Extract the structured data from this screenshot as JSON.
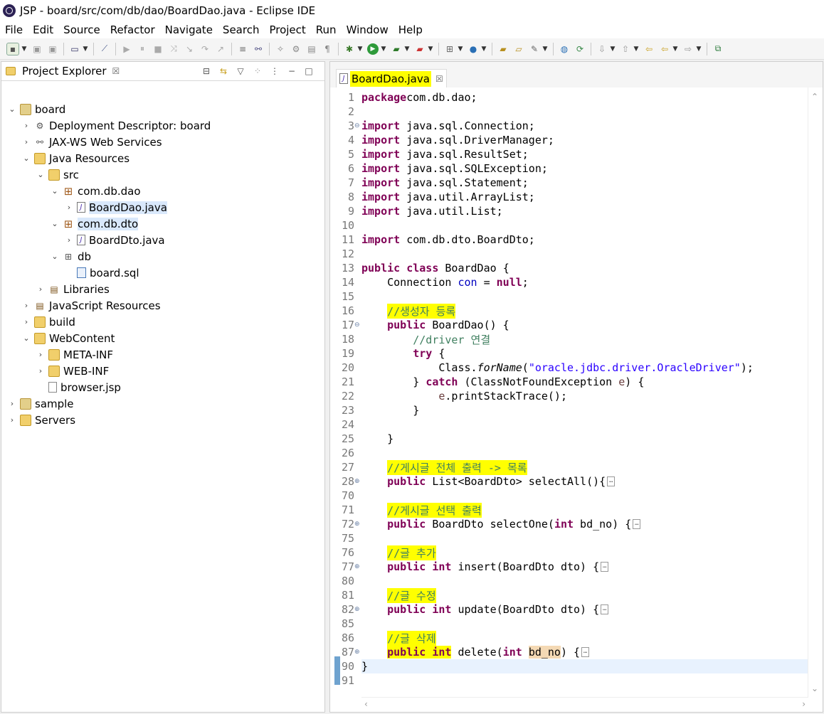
{
  "window": {
    "title": "JSP - board/src/com/db/dao/BoardDao.java - Eclipse IDE"
  },
  "menu": [
    "File",
    "Edit",
    "Source",
    "Refactor",
    "Navigate",
    "Search",
    "Project",
    "Run",
    "Window",
    "Help"
  ],
  "explorer": {
    "tab_label": "Project Explorer",
    "close_glyph": "☒",
    "tree": [
      {
        "label": "board",
        "depth": 0,
        "twisty": "open",
        "icon": "project"
      },
      {
        "label": "Deployment Descriptor: board",
        "depth": 1,
        "twisty": "closed",
        "icon": "descriptor"
      },
      {
        "label": "JAX-WS Web Services",
        "depth": 1,
        "twisty": "closed",
        "icon": "webservice"
      },
      {
        "label": "Java Resources",
        "depth": 1,
        "twisty": "open",
        "icon": "folder"
      },
      {
        "label": "src",
        "depth": 2,
        "twisty": "open",
        "icon": "srcfolder"
      },
      {
        "label": "com.db.dao",
        "depth": 3,
        "twisty": "open",
        "icon": "package"
      },
      {
        "label": "BoardDao.java",
        "depth": 4,
        "twisty": "closed",
        "icon": "java",
        "selected": true
      },
      {
        "label": "com.db.dto",
        "depth": 3,
        "twisty": "open",
        "icon": "package",
        "selected": true
      },
      {
        "label": "BoardDto.java",
        "depth": 4,
        "twisty": "closed",
        "icon": "java"
      },
      {
        "label": "db",
        "depth": 3,
        "twisty": "open",
        "icon": "package-empty"
      },
      {
        "label": "board.sql",
        "depth": 4,
        "twisty": "none",
        "icon": "sql"
      },
      {
        "label": "Libraries",
        "depth": 2,
        "twisty": "closed",
        "icon": "library"
      },
      {
        "label": "JavaScript Resources",
        "depth": 1,
        "twisty": "closed",
        "icon": "library"
      },
      {
        "label": "build",
        "depth": 1,
        "twisty": "closed",
        "icon": "folder"
      },
      {
        "label": "WebContent",
        "depth": 1,
        "twisty": "open",
        "icon": "folder"
      },
      {
        "label": "META-INF",
        "depth": 2,
        "twisty": "closed",
        "icon": "folder"
      },
      {
        "label": "WEB-INF",
        "depth": 2,
        "twisty": "closed",
        "icon": "folder"
      },
      {
        "label": "browser.jsp",
        "depth": 2,
        "twisty": "none",
        "icon": "jsp"
      },
      {
        "label": "sample",
        "depth": 0,
        "twisty": "closed",
        "icon": "project"
      },
      {
        "label": "Servers",
        "depth": 0,
        "twisty": "closed",
        "icon": "folder"
      }
    ]
  },
  "editor": {
    "tab_label": "BoardDao.java",
    "close_glyph": "☒",
    "lines": [
      {
        "n": "1",
        "segs": [
          [
            "kw",
            "package"
          ],
          [
            "",
            "com.db.dao;"
          ]
        ]
      },
      {
        "n": "2",
        "segs": []
      },
      {
        "n": "3",
        "fold": "⊖",
        "segs": [
          [
            "kw",
            "import"
          ],
          [
            "",
            " java.sql.Connection;"
          ]
        ]
      },
      {
        "n": "4",
        "segs": [
          [
            "kw",
            "import"
          ],
          [
            "",
            " java.sql.DriverManager;"
          ]
        ]
      },
      {
        "n": "5",
        "segs": [
          [
            "kw",
            "import"
          ],
          [
            "",
            " java.sql.ResultSet;"
          ]
        ]
      },
      {
        "n": "6",
        "segs": [
          [
            "kw",
            "import"
          ],
          [
            "",
            " java.sql.SQLException;"
          ]
        ]
      },
      {
        "n": "7",
        "segs": [
          [
            "kw",
            "import"
          ],
          [
            "",
            " java.sql.Statement;"
          ]
        ]
      },
      {
        "n": "8",
        "segs": [
          [
            "kw",
            "import"
          ],
          [
            "",
            " java.util.ArrayList;"
          ]
        ]
      },
      {
        "n": "9",
        "segs": [
          [
            "kw",
            "import"
          ],
          [
            "",
            " java.util.List;"
          ]
        ]
      },
      {
        "n": "10",
        "segs": []
      },
      {
        "n": "11",
        "segs": [
          [
            "kw",
            "import"
          ],
          [
            "",
            " com.db.dto.BoardDto;"
          ]
        ]
      },
      {
        "n": "12",
        "segs": []
      },
      {
        "n": "13",
        "segs": [
          [
            "kw",
            "public"
          ],
          [
            "",
            " "
          ],
          [
            "kw",
            "class"
          ],
          [
            "",
            " BoardDao "
          ],
          [
            "",
            "{"
          ]
        ]
      },
      {
        "n": "14",
        "segs": [
          [
            "",
            "    Connection "
          ],
          [
            "fld",
            "con"
          ],
          [
            "",
            " = "
          ],
          [
            "kw",
            "null"
          ],
          [
            "",
            ";"
          ]
        ]
      },
      {
        "n": "15",
        "segs": []
      },
      {
        "n": "16",
        "segs": [
          [
            "",
            "    "
          ],
          [
            "cmt hl",
            "//생성자 등록"
          ]
        ]
      },
      {
        "n": "17",
        "fold": "⊖",
        "segs": [
          [
            "",
            "    "
          ],
          [
            "kw",
            "public"
          ],
          [
            "",
            " BoardDao() {"
          ]
        ]
      },
      {
        "n": "18",
        "segs": [
          [
            "",
            "        "
          ],
          [
            "cmt",
            "//driver 연결"
          ]
        ]
      },
      {
        "n": "19",
        "segs": [
          [
            "",
            "        "
          ],
          [
            "kw",
            "try"
          ],
          [
            "",
            " {"
          ]
        ]
      },
      {
        "n": "20",
        "segs": [
          [
            "",
            "            Class."
          ],
          [
            "itl",
            "forName"
          ],
          [
            "",
            "("
          ],
          [
            "str",
            "\"oracle.jdbc.driver.OracleDriver\""
          ],
          [
            "",
            ");"
          ]
        ]
      },
      {
        "n": "21",
        "segs": [
          [
            "",
            "        } "
          ],
          [
            "kw",
            "catch"
          ],
          [
            "",
            " (ClassNotFoundException "
          ],
          [
            "param",
            "e"
          ],
          [
            "",
            ") {"
          ]
        ]
      },
      {
        "n": "22",
        "segs": [
          [
            "",
            "            "
          ],
          [
            "param",
            "e"
          ],
          [
            "",
            ".printStackTrace();"
          ]
        ]
      },
      {
        "n": "23",
        "segs": [
          [
            "",
            "        }"
          ]
        ]
      },
      {
        "n": "24",
        "segs": []
      },
      {
        "n": "25",
        "segs": [
          [
            "",
            "    }"
          ]
        ]
      },
      {
        "n": "26",
        "segs": []
      },
      {
        "n": "27",
        "segs": [
          [
            "",
            "    "
          ],
          [
            "cmt hl",
            "//게시글 전체 출력 -> 목록"
          ]
        ]
      },
      {
        "n": "28",
        "fold": "⊕",
        "segs": [
          [
            "",
            "    "
          ],
          [
            "kw",
            "public"
          ],
          [
            "",
            " List<BoardDto> selectAll(){"
          ],
          [
            "box",
            "…"
          ]
        ]
      },
      {
        "n": "70",
        "segs": []
      },
      {
        "n": "71",
        "segs": [
          [
            "",
            "    "
          ],
          [
            "cmt hl",
            "//게시글 선택 출력"
          ]
        ]
      },
      {
        "n": "72",
        "fold": "⊕",
        "segs": [
          [
            "",
            "    "
          ],
          [
            "kw",
            "public"
          ],
          [
            "",
            " BoardDto selectOne("
          ],
          [
            "kw",
            "int"
          ],
          [
            "",
            " bd_no) {"
          ],
          [
            "box",
            "…"
          ]
        ]
      },
      {
        "n": "75",
        "segs": []
      },
      {
        "n": "76",
        "segs": [
          [
            "",
            "    "
          ],
          [
            "cmt hl",
            "//글 추가"
          ]
        ]
      },
      {
        "n": "77",
        "fold": "⊕",
        "segs": [
          [
            "",
            "    "
          ],
          [
            "kw",
            "public"
          ],
          [
            "",
            " "
          ],
          [
            "kw",
            "int"
          ],
          [
            "",
            " insert(BoardDto dto) {"
          ],
          [
            "box",
            "…"
          ]
        ]
      },
      {
        "n": "80",
        "segs": []
      },
      {
        "n": "81",
        "segs": [
          [
            "",
            "    "
          ],
          [
            "cmt hl",
            "//글 수정"
          ]
        ]
      },
      {
        "n": "82",
        "fold": "⊕",
        "segs": [
          [
            "",
            "    "
          ],
          [
            "kw",
            "public"
          ],
          [
            "",
            " "
          ],
          [
            "kw",
            "int"
          ],
          [
            "",
            " update(BoardDto dto) {"
          ],
          [
            "box",
            "…"
          ]
        ]
      },
      {
        "n": "85",
        "segs": []
      },
      {
        "n": "86",
        "segs": [
          [
            "",
            "    "
          ],
          [
            "cmt hl",
            "//글 삭제"
          ]
        ]
      },
      {
        "n": "87",
        "fold": "⊕",
        "segs": [
          [
            "",
            "    "
          ],
          [
            "kw hl",
            "public"
          ],
          [
            "hl",
            " "
          ],
          [
            "kw hl",
            "int"
          ],
          [
            "",
            " delete("
          ],
          [
            "kw",
            "int"
          ],
          [
            "",
            " "
          ],
          [
            "occur",
            "bd_no"
          ],
          [
            "",
            ") {"
          ],
          [
            "box",
            "…"
          ]
        ]
      },
      {
        "n": "90",
        "segs": [
          [
            "",
            "}"
          ]
        ],
        "current": true
      },
      {
        "n": "91",
        "segs": []
      }
    ]
  }
}
